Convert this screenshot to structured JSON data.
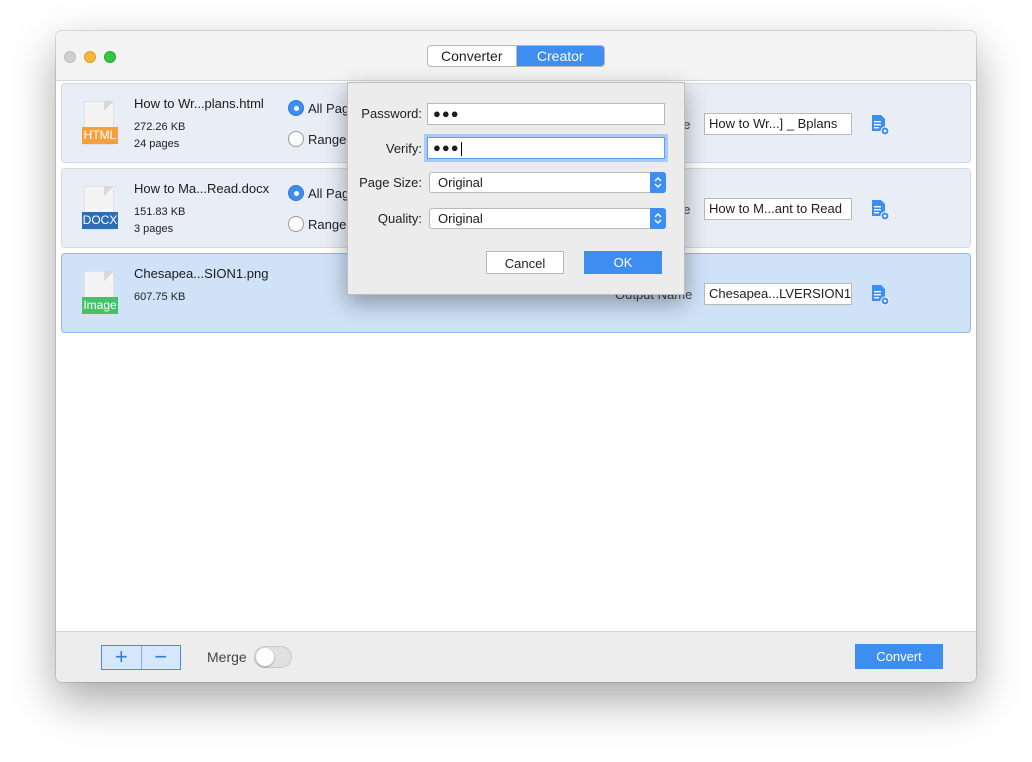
{
  "tabs": [
    {
      "label": "Converter",
      "active": false
    },
    {
      "label": "Creator",
      "active": true
    }
  ],
  "files": [
    {
      "type_label": "HTML",
      "name": "How to Wr...plans.html",
      "size": "272.26 KB",
      "pages": "24 pages",
      "radio_all": "All Pag",
      "radio_range": "Range",
      "output_label": "ne",
      "output_name": "How to Wr...] _ Bplans"
    },
    {
      "type_label": "DOCX",
      "name": "How to Ma...Read.docx",
      "size": "151.83 KB",
      "pages": "3 pages",
      "radio_all": "All Pag",
      "radio_range": "Range",
      "output_label": "ne",
      "output_name": "How to M...ant to Read"
    },
    {
      "type_label": "Image",
      "name": "Chesapea...SION1.png",
      "size": "607.75 KB",
      "output_label": "Output Name",
      "output_name": "Chesapea...LVERSION1"
    }
  ],
  "footer": {
    "merge_label": "Merge",
    "merge_on": false,
    "convert_label": "Convert"
  },
  "dialog": {
    "password_label": "Password:",
    "password_value": "●●●",
    "verify_label": "Verify:",
    "verify_value": "●●●",
    "page_size_label": "Page Size:",
    "page_size_value": "Original",
    "quality_label": "Quality:",
    "quality_value": "Original",
    "cancel_label": "Cancel",
    "ok_label": "OK"
  },
  "colors": {
    "accent": "#3d8ef0",
    "html_tag": "#f5a03c",
    "docx_tag": "#2f6db5",
    "image_tag": "#46c06a"
  }
}
